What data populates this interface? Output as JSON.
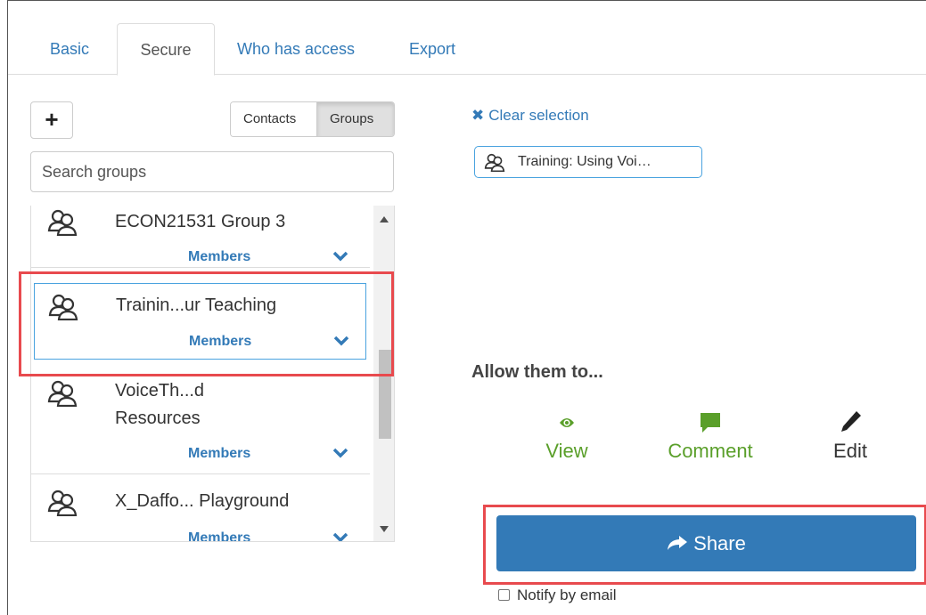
{
  "tabs": {
    "basic": "Basic",
    "secure": "Secure",
    "who_has_access": "Who has access",
    "export": "Export"
  },
  "left": {
    "add_label": "+",
    "toggle": {
      "contacts": "Contacts",
      "groups": "Groups",
      "active": "Groups"
    },
    "search_placeholder": "Search groups",
    "groups": [
      {
        "name": "ECON21531 Group 3",
        "members": "Members"
      },
      {
        "name": "Trainin...ur Teaching",
        "members": "Members"
      },
      {
        "name_line1": "VoiceTh...d",
        "name_line2": "Resources",
        "members": "Members"
      },
      {
        "name": "X_Daffo... Playground",
        "members": "Members"
      }
    ]
  },
  "right": {
    "clear_selection": "Clear selection",
    "selected_chip": "Training: Using Voi…",
    "allow_heading": "Allow them to...",
    "permissions": {
      "view": "View",
      "comment": "Comment",
      "edit": "Edit"
    },
    "share_label": "Share",
    "notify_label": "Notify by email"
  },
  "colors": {
    "link": "#337ab7",
    "share_bg": "#337ab7",
    "permission_active": "#5a9f2a",
    "highlight": "#e84a4e",
    "selected_border": "#4aa3df"
  }
}
